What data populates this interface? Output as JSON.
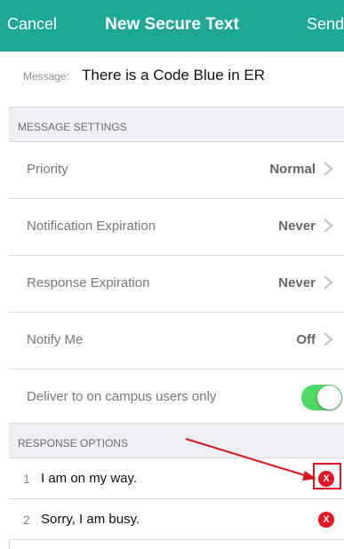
{
  "navbar": {
    "cancel_label": "Cancel",
    "title": "New Secure Text",
    "send_label": "Send",
    "color": "#1ea896"
  },
  "message": {
    "label": "Message:",
    "text": "There is a Code Blue in ER"
  },
  "message_settings": {
    "header": "MESSAGE SETTINGS",
    "rows": [
      {
        "label": "Priority",
        "value": "Normal",
        "icon": "chevron-right-icon"
      },
      {
        "label": "Notification Expiration",
        "value": "Never",
        "icon": "chevron-right-icon"
      },
      {
        "label": "Response Expiration",
        "value": "Never",
        "icon": "chevron-right-icon"
      },
      {
        "label": "Notify Me",
        "value": "Off",
        "icon": "chevron-right-icon"
      }
    ],
    "toggle_row": {
      "label": "Deliver to on campus users only",
      "on": true,
      "color": "#4cd964"
    }
  },
  "response_options": {
    "header": "RESPONSE OPTIONS",
    "items": [
      {
        "number": "1",
        "text": "I am on my way.",
        "delete_glyph": "X"
      },
      {
        "number": "2",
        "text": "Sorry, I am busy.",
        "delete_glyph": "X"
      }
    ]
  },
  "annotation": {
    "color": "#e0161f"
  }
}
